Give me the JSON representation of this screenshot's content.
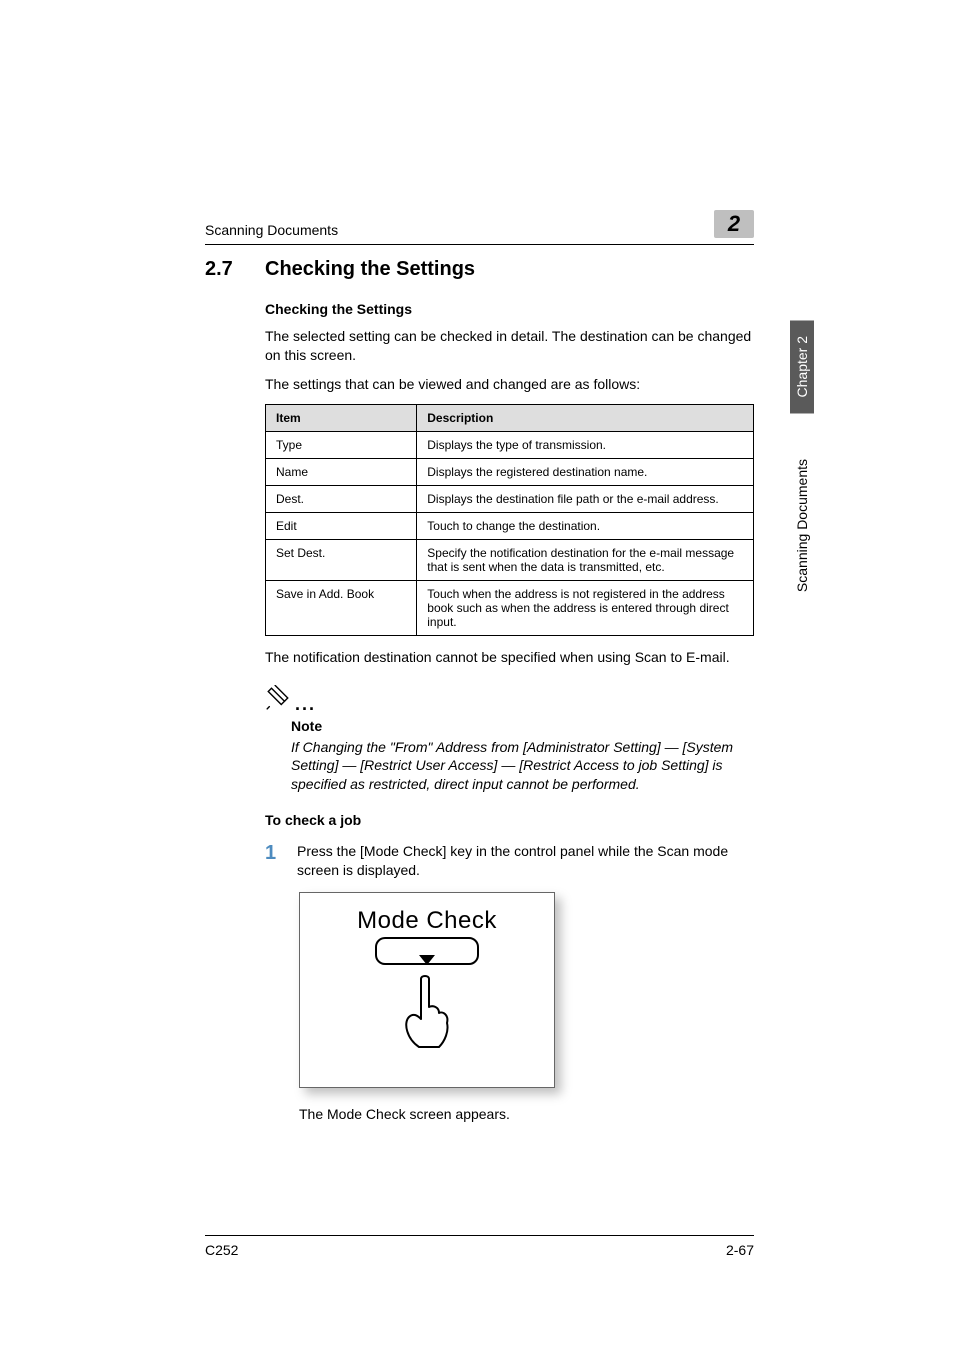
{
  "header": {
    "running_title": "Scanning Documents",
    "chapter_number": "2"
  },
  "side": {
    "tab_dark": "Chapter 2",
    "tab_light": "Scanning Documents"
  },
  "section": {
    "number": "2.7",
    "title": "Checking the Settings"
  },
  "subheading1": "Checking the Settings",
  "intro1": "The selected setting can be checked in detail. The destination can be changed on this screen.",
  "intro2": "The settings that can be viewed and changed are as follows:",
  "table": {
    "headers": {
      "item": "Item",
      "desc": "Description"
    },
    "rows": [
      {
        "item": "Type",
        "desc": "Displays the type of transmission."
      },
      {
        "item": "Name",
        "desc": "Displays the registered destination name."
      },
      {
        "item": "Dest.",
        "desc": "Displays the destination file path or the e-mail address."
      },
      {
        "item": "Edit",
        "desc": "Touch to change the destination."
      },
      {
        "item": "Set Dest.",
        "desc": "Specify the notification destination for the e-mail message that is sent when the data is transmitted, etc."
      },
      {
        "item": "Save in Add. Book",
        "desc": "Touch when the address is not registered in the address book such as when the address is entered through direct input."
      }
    ]
  },
  "after_table": "The notification destination cannot be specified when using Scan to E-mail.",
  "note": {
    "label": "Note",
    "body": "If Changing the \"From\" Address from [Administrator Setting] — [System Setting] — [Restrict User Access] — [Restrict Access to job Setting] is specified as restricted, direct input cannot be performed."
  },
  "subheading2": "To check a job",
  "step": {
    "num": "1",
    "text": "Press the [Mode Check] key in the control panel while the Scan mode screen is displayed."
  },
  "figure": {
    "label": "Mode Check"
  },
  "result_text": "The Mode Check screen appears.",
  "footer": {
    "left": "C252",
    "right": "2-67"
  }
}
